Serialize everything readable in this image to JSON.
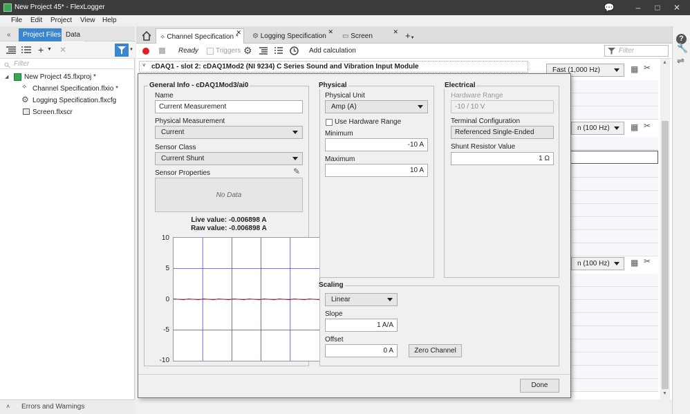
{
  "window": {
    "title": "New Project 45* - FlexLogger"
  },
  "menu": [
    "File",
    "Edit",
    "Project",
    "View",
    "Help"
  ],
  "left": {
    "collapse": "«",
    "tabs": [
      "Project Files",
      "Data"
    ],
    "filter_placeholder": "Filter",
    "tree": [
      {
        "label": "New Project 45.flxproj *"
      },
      {
        "label": "Channel Specification.flxio *"
      },
      {
        "label": "Logging Specification.flxcfg"
      },
      {
        "label": "Screen.flxscr"
      }
    ],
    "status": "Errors and Warnings"
  },
  "doc_tabs": [
    "Channel Specification *",
    "Logging Specification",
    "Screen"
  ],
  "toolbar": {
    "status": "Ready",
    "triggers": "Triggers",
    "add_calc": "Add calculation",
    "filter_placeholder": "Filter"
  },
  "sheet": {
    "module_header": "cDAQ1 - slot 2: cDAQ1Mod2 (NI 9234) C Series Sound and Vibration Input Module",
    "rate_1": "Fast (1,000 Hz)",
    "rate_2": "n (100 Hz)",
    "rate_3": "n (100 Hz)"
  },
  "dialog": {
    "general": {
      "title": "General Info - cDAQ1Mod3/ai0",
      "name_label": "Name",
      "name_value": "Current Measurement",
      "phys_meas_label": "Physical Measurement",
      "phys_meas_value": "Current",
      "sensor_class_label": "Sensor Class",
      "sensor_class_value": "Current Shunt",
      "sensor_props_label": "Sensor Properties",
      "no_data": "No Data",
      "live": "Live value: -0.006898 A",
      "raw": "Raw value: -0.006898 A"
    },
    "physical": {
      "title": "Physical",
      "unit_label": "Physical Unit",
      "unit_value": "Amp (A)",
      "use_hw_range": "Use Hardware Range",
      "min_label": "Minimum",
      "min_value": "-10 A",
      "max_label": "Maximum",
      "max_value": "10 A"
    },
    "electrical": {
      "title": "Electrical",
      "hw_range_label": "Hardware Range",
      "hw_range_value": "-10 / 10 V",
      "term_label": "Terminal Configuration",
      "term_value": "Referenced Single-Ended",
      "shunt_label": "Shunt Resistor Value",
      "shunt_value": "1 Ω"
    },
    "scaling": {
      "title": "Scaling",
      "type_value": "Linear",
      "slope_label": "Slope",
      "slope_value": "1 A/A",
      "offset_label": "Offset",
      "offset_value": "0 A",
      "zero_button": "Zero Channel"
    },
    "done": "Done"
  },
  "chart_data": {
    "type": "line",
    "yticks": [
      "10",
      "5",
      "0",
      "-5",
      "-10"
    ],
    "ylim": [
      -10,
      10
    ],
    "grid": true,
    "series": [
      {
        "values": [
          -0.006898,
          -0.006898,
          -0.006898,
          -0.006898,
          -0.006898,
          -0.006898,
          -0.006898,
          -0.006898,
          -0.006898,
          -0.006898,
          -0.006898,
          -0.006898,
          -0.006898,
          -0.006898,
          -0.006898,
          -0.006898,
          -0.006898,
          -0.006898,
          -0.006898,
          -0.006898,
          -0.006898,
          -0.006898,
          -0.006898,
          -0.006898,
          -0.006898,
          -0.006898,
          -0.006898,
          -0.006898,
          -0.006898,
          -0.006898
        ],
        "color": "#8b1a1a"
      }
    ]
  },
  "colors": {
    "accent": "#3c85d0",
    "titlebar": "#3b3b3b",
    "record": "#e02020",
    "trace": "#8b1a1a"
  }
}
